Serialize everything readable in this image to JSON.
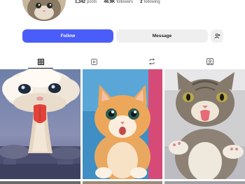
{
  "profile": {
    "posts_count": "1,342",
    "posts_label": "posts",
    "followers_count": "46.9K",
    "followers_label": "followers",
    "following_count": "2",
    "following_label": "following"
  },
  "actions": {
    "follow_label": "Follow",
    "message_label": "Message"
  },
  "tabs": [
    {
      "name": "posts",
      "icon": "grid-icon",
      "active": true
    },
    {
      "name": "reels",
      "icon": "reels-icon",
      "active": false
    },
    {
      "name": "reposts",
      "icon": "repost-icon",
      "active": false
    },
    {
      "name": "tagged",
      "icon": "tagged-icon",
      "active": false
    }
  ],
  "colors": {
    "accent": "#4a5df9",
    "secondary_button": "#efefef"
  }
}
